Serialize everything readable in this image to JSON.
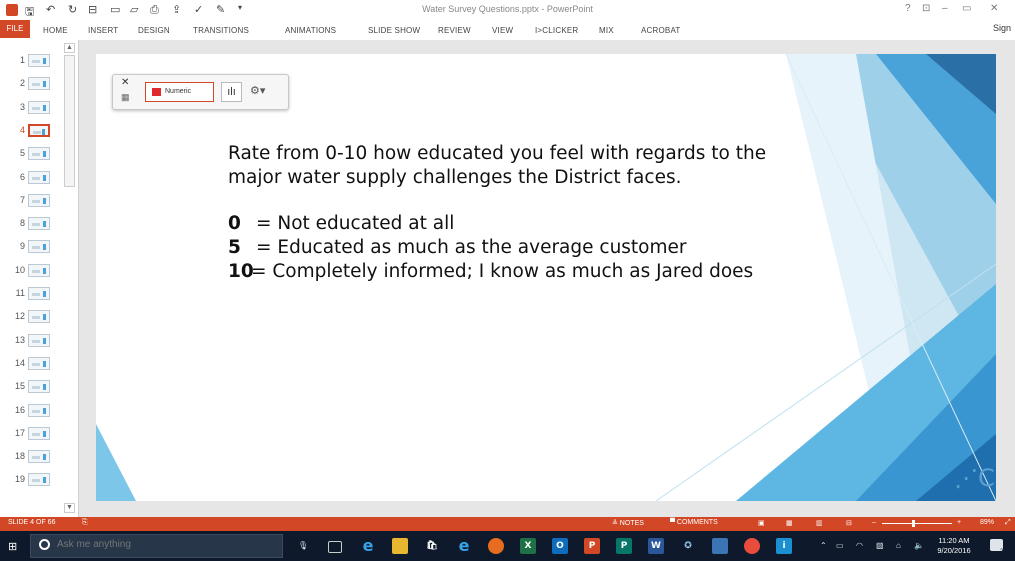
{
  "window": {
    "title": "Water Survey Questions.pptx - PowerPoint",
    "controls": [
      "?",
      "⊡",
      "–",
      "▭",
      "✕"
    ],
    "sign_in": "Sign"
  },
  "quick_access": {
    "icons": [
      "powerpoint-app-icon",
      "save-icon",
      "undo-icon",
      "redo-icon",
      "start-from-beginning-icon",
      "new-icon",
      "open-icon",
      "print-icon",
      "share-icon",
      "spelling-icon",
      "brush-icon",
      "customize-qat-icon"
    ]
  },
  "ribbon": {
    "tabs": [
      "FILE",
      "HOME",
      "INSERT",
      "DESIGN",
      "TRANSITIONS",
      "ANIMATIONS",
      "SLIDE SHOW",
      "REVIEW",
      "VIEW",
      "I>CLICKER",
      "MIX",
      "ACROBAT"
    ]
  },
  "thumbnails": {
    "numbers": [
      "1",
      "2",
      "3",
      "4",
      "5",
      "6",
      "7",
      "8",
      "9",
      "10",
      "11",
      "12",
      "13",
      "14",
      "15",
      "16",
      "17",
      "18",
      "19"
    ],
    "active_index": 3
  },
  "slide": {
    "question_line1": "Rate from 0-10 how educated you feel with regards to the",
    "question_line2": "major water supply challenges the District faces.",
    "scale": [
      {
        "key": "0",
        "text": "= Not educated at all"
      },
      {
        "key": "5",
        "text": "= Educated as much as the average customer"
      },
      {
        "key": "10",
        "text": "= Completely informed; I know as much as Jared does"
      }
    ],
    "logo_glyph": "⋰C",
    "widget": {
      "close": "✕",
      "image_icon": "▦",
      "mode_label": "Numeric",
      "chart_icon": "ılı",
      "gear_icon": "⚙▾"
    }
  },
  "statusbar": {
    "slide_info": "SLIDE 4 OF 66",
    "notes": "≜ NOTES",
    "comments": "▀ COMMENTS",
    "zoom": "89%"
  },
  "taskbar": {
    "search_placeholder": "Ask me anything",
    "time": "11:20 AM",
    "date": "9/20/2016",
    "notification_count": "2"
  },
  "colors": {
    "accent": "#d24726",
    "taskbar": "#0e1a2b",
    "slide_blue": "#4aa3d8"
  }
}
